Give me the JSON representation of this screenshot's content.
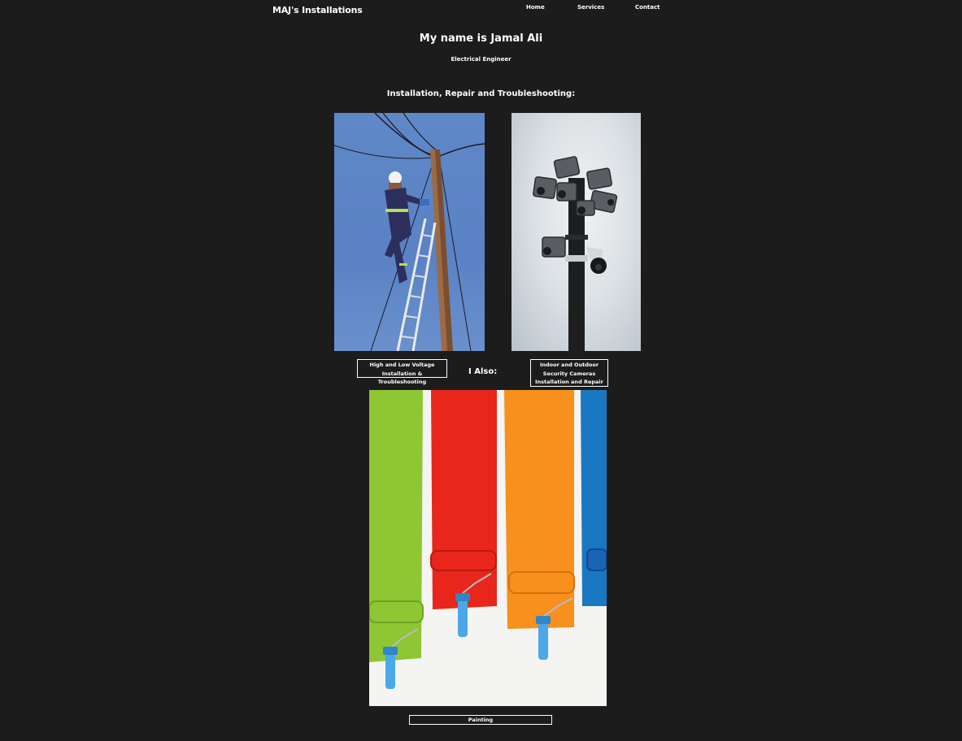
{
  "header": {
    "brand": "MAJ's Installations",
    "nav": [
      {
        "label": "Home"
      },
      {
        "label": "Services"
      },
      {
        "label": "Contact"
      }
    ]
  },
  "hero": {
    "title": "My name is Jamal Ali",
    "subtitle": "Electrical Engineer"
  },
  "services": {
    "heading": "Installation, Repair and Troubleshooting:",
    "items": [
      {
        "caption": "High and Low Voltage\nInstallation & Troubleshooting",
        "image": "electrician-on-pole-photo"
      },
      {
        "caption": "Indoor and Outdoor\nSecurity Cameras\nInstallation and Repair",
        "image": "cctv-pole-photo"
      }
    ],
    "also_label": "I Also:",
    "extra": {
      "caption": "Painting",
      "image": "paint-rollers-photo"
    }
  },
  "colors": {
    "background": "#1c1c1c",
    "text": "#ffffff",
    "paint": [
      "#8ec634",
      "#e8261b",
      "#f7901d",
      "#1a78c2"
    ]
  }
}
